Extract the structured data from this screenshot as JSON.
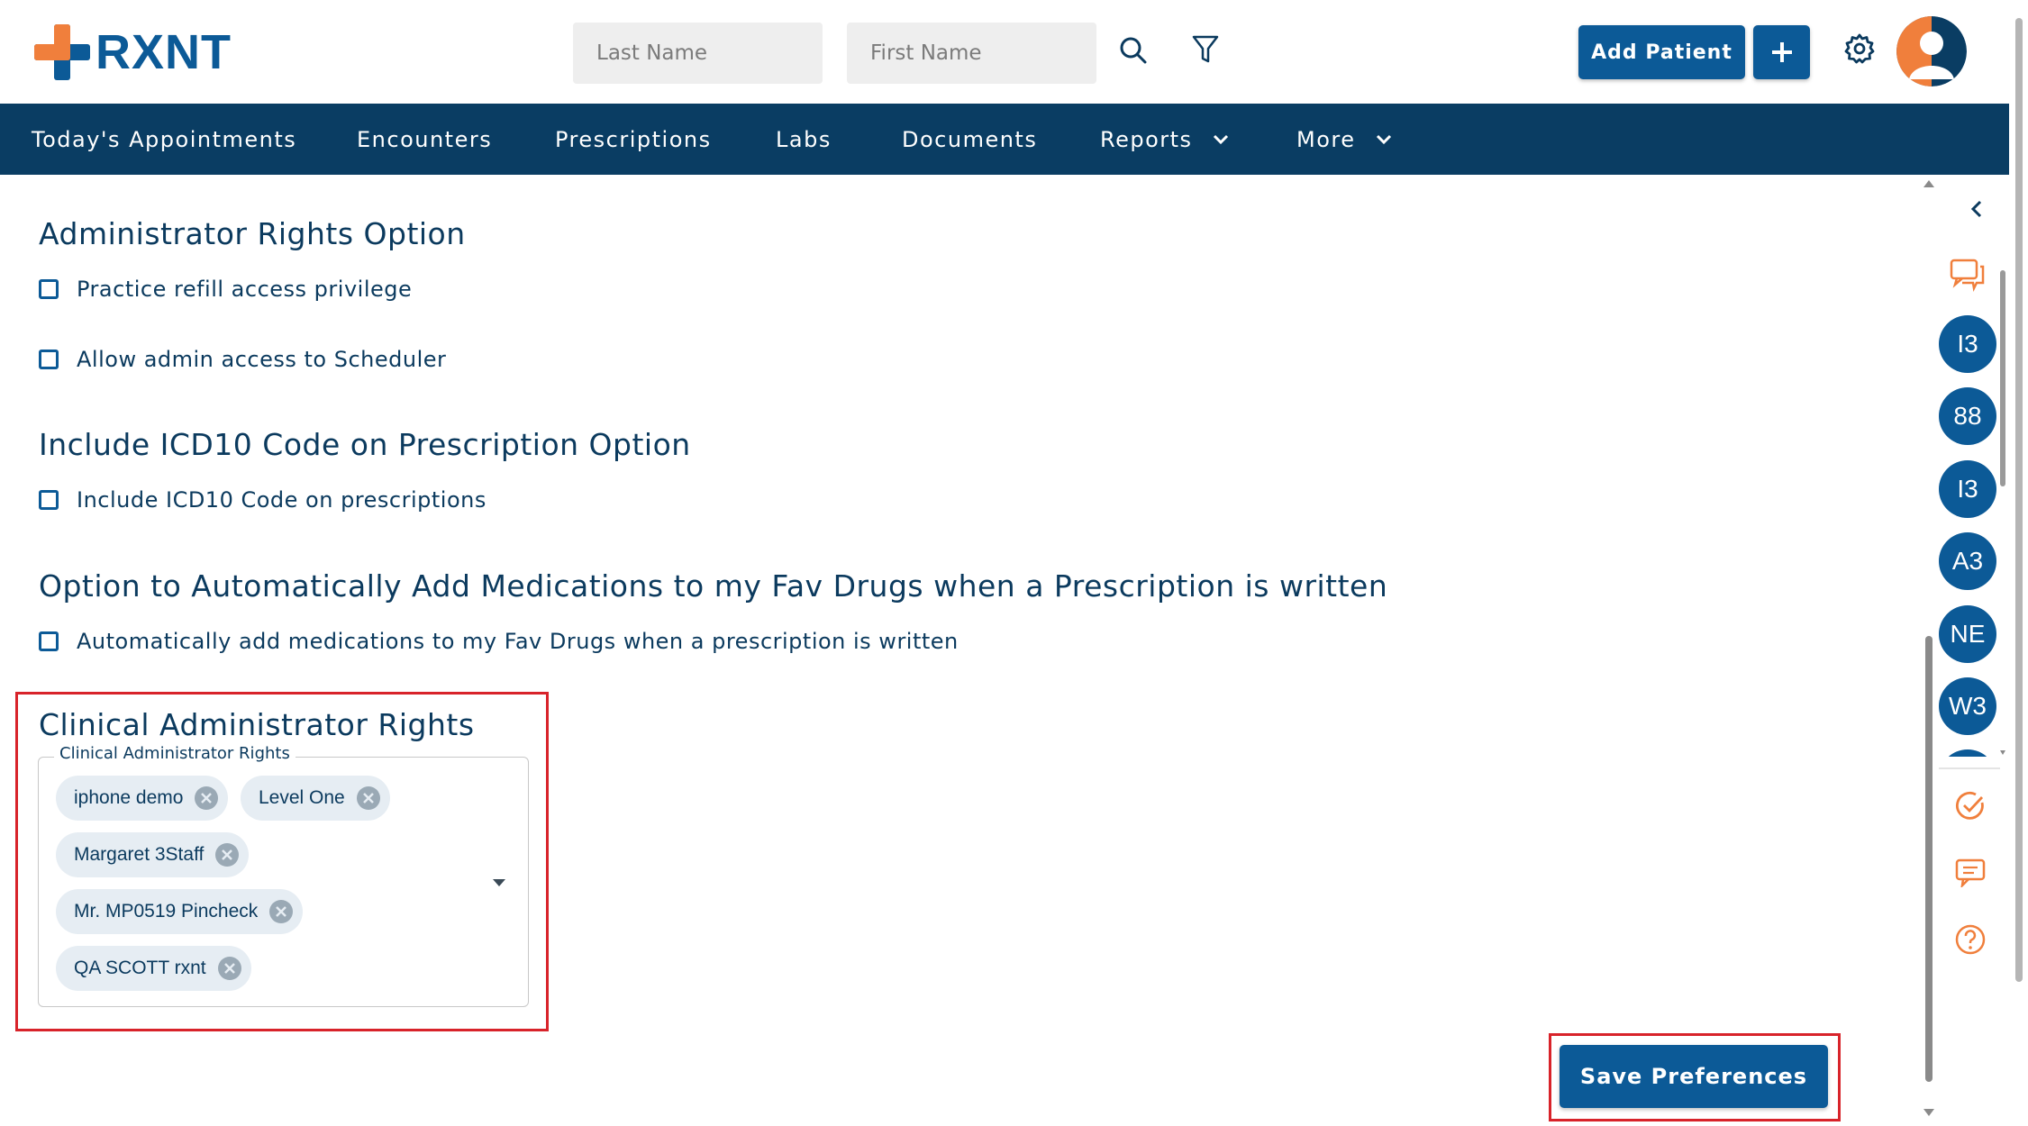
{
  "header": {
    "brand": "RXNT",
    "last_name_placeholder": "Last Name",
    "first_name_placeholder": "First Name",
    "add_patient_label": "Add Patient"
  },
  "nav": {
    "items": [
      "Today's Appointments",
      "Encounters",
      "Prescriptions",
      "Labs",
      "Documents",
      "Reports",
      "More"
    ]
  },
  "sections": {
    "admin_rights": {
      "title": "Administrator Rights Option",
      "options": [
        "Practice refill access privilege",
        "Allow admin access to Scheduler"
      ]
    },
    "icd10": {
      "title": "Include ICD10 Code on Prescription Option",
      "options": [
        "Include ICD10 Code on prescriptions"
      ]
    },
    "fav_drugs": {
      "title": "Option to Automatically Add Medications to my Fav Drugs when a Prescription is written",
      "options": [
        "Automatically add medications to my Fav Drugs when a prescription is written"
      ]
    },
    "clinical_admin": {
      "title": "Clinical Administrator Rights",
      "field_label": "Clinical Administrator Rights",
      "selected": [
        "iphone demo",
        "Level One",
        "Margaret 3Staff",
        "Mr. MP0519 Pincheck",
        "QA SCOTT rxnt"
      ]
    }
  },
  "save_button_label": "Save Preferences",
  "right_panel": {
    "user_circles": [
      "I3",
      "88",
      "I3",
      "A3",
      "NE",
      "W3"
    ]
  },
  "colors": {
    "primary": "#0c5a97",
    "nav_bg": "#0a3d63",
    "accent_orange": "#f07f3c",
    "highlight_red": "#d8232a"
  }
}
